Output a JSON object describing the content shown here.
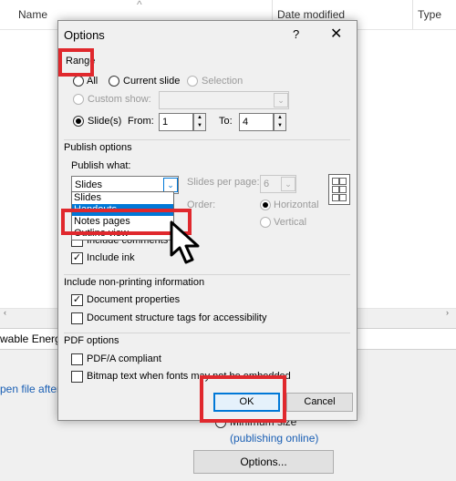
{
  "background": {
    "columns": {
      "name": "Name",
      "date_modified": "Date modified",
      "type": "Type"
    },
    "file_name_partial": "wable Energy",
    "open_file_after": "pen file after",
    "minimum_size": "Minimum size",
    "publishing_online": "(publishing online)",
    "options_button": "Options..."
  },
  "dialog": {
    "title": "Options",
    "help": "?",
    "close": "✕",
    "range": {
      "heading": "Range",
      "all": "All",
      "current_slide": "Current slide",
      "selection": "Selection",
      "custom_show": "Custom show:",
      "slides": "Slide(s)",
      "from_label": "From:",
      "from_value": "1",
      "to_label": "To:",
      "to_value": "4"
    },
    "publish_options": {
      "heading": "Publish options",
      "publish_what_label": "Publish what:",
      "publish_what_value": "Slides",
      "dropdown_items": [
        "Slides",
        "Handouts",
        "Notes pages",
        "Outline view"
      ],
      "slides_per_page_label": "Slides per page:",
      "slides_per_page_value": "6",
      "order_label": "Order:",
      "horizontal": "Horizontal",
      "vertical": "Vertical",
      "include_comments": "Include comments",
      "include_ink": "Include ink"
    },
    "non_printing": {
      "heading": "Include non-printing information",
      "document_properties": "Document properties",
      "structure_tags": "Document structure tags for accessibility"
    },
    "pdf_options": {
      "heading": "PDF options",
      "pdfa": "PDF/A compliant",
      "bitmap_text": "Bitmap text when fonts may not be embedded"
    },
    "ok": "OK",
    "cancel": "Cancel"
  },
  "colors": {
    "highlight_box": "#e0282d",
    "selection_blue": "#0078d7"
  }
}
